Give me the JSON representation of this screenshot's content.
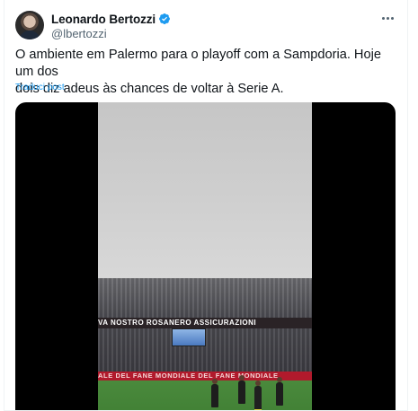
{
  "author": {
    "display_name": "Leonardo Bertozzi",
    "handle": "@lbertozzi",
    "verified": true,
    "verified_badge_color": "#1d9bf0"
  },
  "tweet": {
    "text": "O ambiente em Palermo para o playoff com a Sampdoria. Hoje um dos\ndois diz adeus às chances de voltar à Serie A.",
    "translate_label": "Traduci post"
  },
  "media": {
    "type": "video",
    "stadium_banner_text": "VA NOSTRO   ROSANERO   ASSICURAZIONI",
    "ad_board_text": "ALE DEL FANE   MONDIALE DEL FANE   MONDIALE"
  },
  "icons": {
    "more": "more-horizontal-icon",
    "verified": "verified-badge-icon"
  },
  "colors": {
    "link": "#1d9bf0",
    "secondary_text": "#536471",
    "primary_text": "#0f1419"
  }
}
